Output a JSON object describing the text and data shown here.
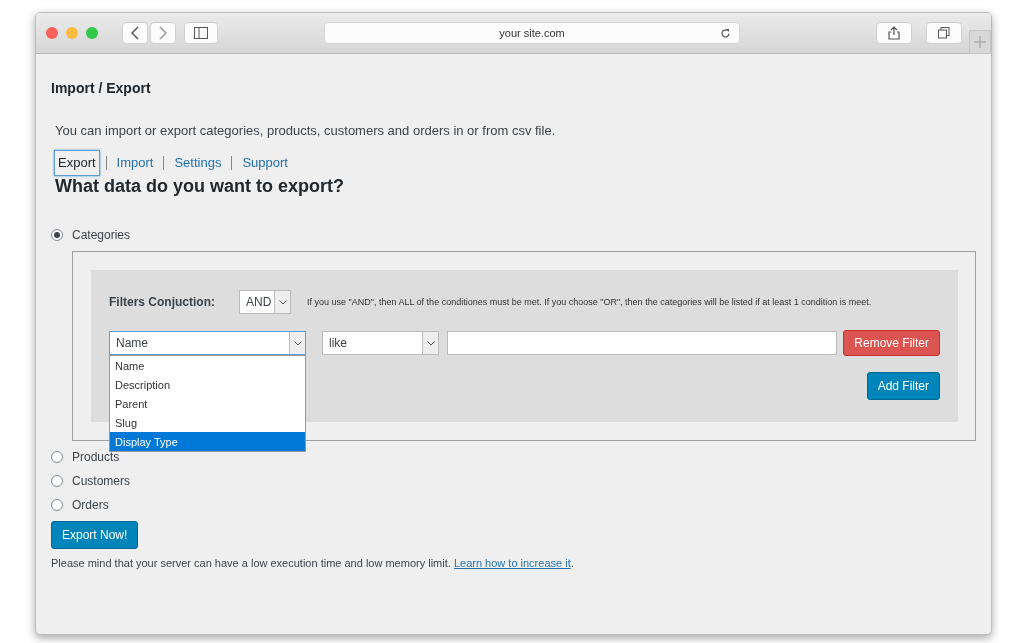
{
  "browser": {
    "address": "your site.com"
  },
  "page": {
    "title": "Import / Export",
    "intro": "You can import or export categories, products, customers and orders in or from csv file.",
    "tabs": [
      {
        "label": "Export",
        "selected": true
      },
      {
        "label": "Import",
        "selected": false
      },
      {
        "label": "Settings",
        "selected": false
      },
      {
        "label": "Support",
        "selected": false
      }
    ],
    "heading": "What data do you want to export?",
    "options": [
      {
        "label": "Categories",
        "selected": true
      },
      {
        "label": "Products",
        "selected": false
      },
      {
        "label": "Customers",
        "selected": false
      },
      {
        "label": "Orders",
        "selected": false
      }
    ],
    "filters": {
      "conjunction_label": "Filters Conjuction:",
      "conjunction": "AND",
      "hint": "If you use \"AND\", then ALL of the conditiones must be met. If you choose \"OR\", then the categories will be listed if at least 1 condition is meet.",
      "field": "Name",
      "operator": "like",
      "remove_button": "Remove Filter",
      "add_button": "Add Filter",
      "field_menu": [
        {
          "label": "Name",
          "selected": false
        },
        {
          "label": "Description",
          "selected": false
        },
        {
          "label": "Parent",
          "selected": false
        },
        {
          "label": "Slug",
          "selected": false
        },
        {
          "label": "Display Type",
          "selected": true
        }
      ]
    },
    "export_button": "Export Now!",
    "note": {
      "text": "Please mind that your server can have a low execution time and low memory limit.",
      "link": "Learn how to increase it",
      "after": "."
    }
  }
}
